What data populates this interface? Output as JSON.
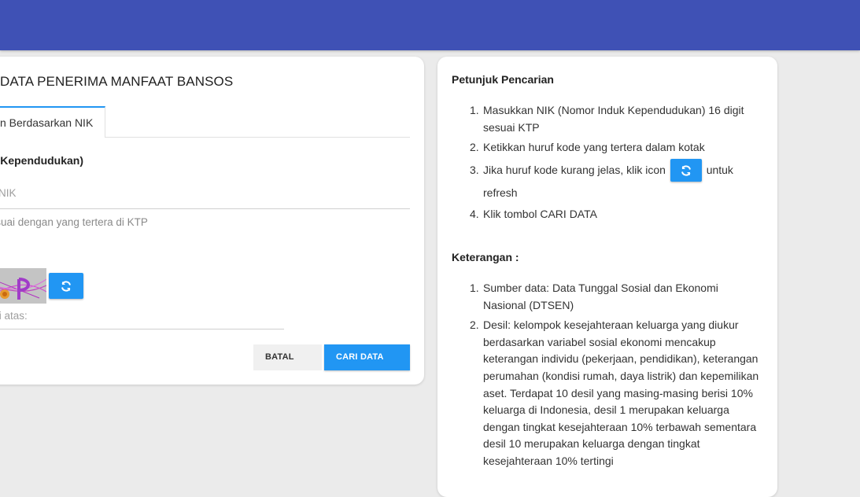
{
  "left": {
    "title": "DATA PENERIMA MANFAAT BANSOS",
    "tab_label": "n Berdasarkan NIK",
    "field_label": "uk Kependudukan)",
    "nik_placeholder": "git NIK",
    "nik_help": "sesuai dengan yang tertera di KTP",
    "captcha_placeholder": "e di atas:",
    "batal_label": "BATAL",
    "cari_label": "CARI DATA"
  },
  "right": {
    "petunjuk_title": "Petunjuk Pencarian",
    "petunjuk": {
      "n1": "1.",
      "t1": "Masukkan NIK (Nomor Induk Kependudukan) 16 digit sesuai KTP",
      "n2": "2.",
      "t2": "Ketikkan huruf kode yang tertera dalam kotak",
      "n3": "3.",
      "t3a": "Jika huruf kode kurang jelas, klik icon",
      "t3b": "untuk refresh",
      "n4": "4.",
      "t4": "Klik tombol CARI DATA"
    },
    "keterangan_title": "Keterangan :",
    "keterangan": {
      "n1": "1.",
      "t1": "Sumber data: Data Tunggal Sosial dan Ekonomi Nasional (DTSEN)",
      "n2": "2.",
      "t2": "Desil: kelompok kesejahteraan keluarga yang diukur berdasarkan variabel sosial ekonomi mencakup keterangan individu (pekerjaan, pendidikan), keterangan perumahan (kondisi rumah, daya listrik) dan kepemilikan aset. Terdapat 10 desil yang masing-masing berisi 10% keluarga di Indonesia, desil 1 merupakan keluarga dengan tingkat kesejahteraan 10% terbawah sementara desil 10 merupakan keluarga dengan tingkat kesejahteraan 10% tertingi"
    }
  },
  "colors": {
    "header": "#3f51b5",
    "accent": "#2196f3",
    "background": "#ebebeb"
  },
  "icons": {
    "refresh": "refresh-icon"
  }
}
